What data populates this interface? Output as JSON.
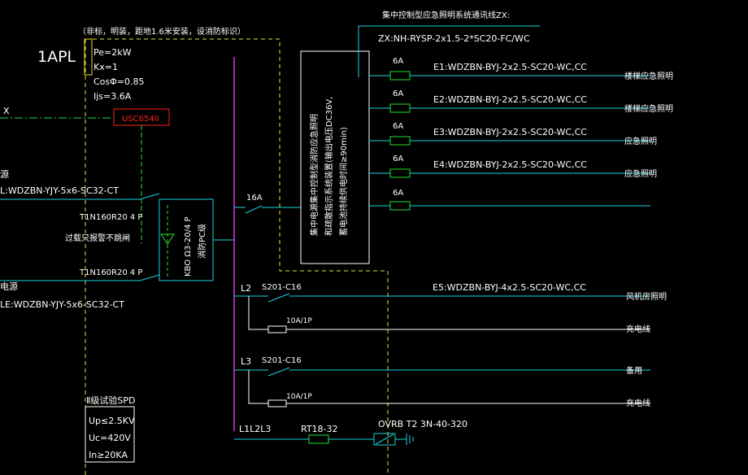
{
  "panel": {
    "name": "1APL",
    "install_note": "（非标，明装，距地1.6米安装，设消防标识）",
    "params": [
      "Pe=2kW",
      "Kx=1",
      "CosΦ=0.85",
      "Ijs=3.6A"
    ]
  },
  "incoming": {
    "line1_prefix": "X",
    "box_label": "USC654II",
    "feed1_tail": "源",
    "feed1_label": "L:WDZBN-YJY-5x6-SC32-CT",
    "feed2_tail": "电源",
    "feed2_label": "LE:WDZBN-YJY-5x6-SC32-CT",
    "breaker1": "T1N160R20 4 P",
    "breaker2": "T1N160R20 4 P",
    "overload_note": "过载只报警不跳闸",
    "ats_label": "KBO Ω3-20/4 P",
    "ats_sub": "消防PC级"
  },
  "emergency": {
    "header": "集中控制型应急照明系统通讯线ZX:",
    "comm_cable": "ZX:NH-RYSP-2x1.5-2*SC20-FC/WC",
    "supply_breaker": "16A",
    "controller_lines": [
      "集中电源集中控制型消防应急照明",
      "和疏散指示系统装置(输出电压DC36V,",
      "蓄电池持续供电时间≥90min)"
    ],
    "circuits": [
      {
        "fuse": "6A",
        "cable": "E1:WDZBN-BYJ-2x2.5-SC20-WC,CC",
        "load": "楼梯应急照明"
      },
      {
        "fuse": "6A",
        "cable": "E2:WDZBN-BYJ-2x2.5-SC20-WC,CC",
        "load": "楼梯应急照明"
      },
      {
        "fuse": "6A",
        "cable": "E3:WDZBN-BYJ-2x2.5-SC20-WC,CC",
        "load": "应急照明"
      },
      {
        "fuse": "6A",
        "cable": "E4:WDZBN-BYJ-2x2.5-SC20-WC,CC",
        "load": "应急照明"
      },
      {
        "fuse": "6A",
        "cable": "",
        "load": ""
      }
    ]
  },
  "branches": [
    {
      "phase": "L2",
      "breaker": "S201-C16",
      "cable": "E5:WDZBN-BYJ-4x2.5-SC20-WC,CC",
      "load": "风机房照明",
      "sub_breaker": "10A/1P",
      "sub_load": "充电线"
    },
    {
      "phase": "L3",
      "breaker": "S201-C16",
      "cable": "",
      "load": "备用",
      "sub_breaker": "10A/1P",
      "sub_load": "充电线"
    }
  ],
  "spd": {
    "title": "Ⅱ级试验SPD",
    "phase": "L1L2L3",
    "fuse": "RT18-32",
    "model": "OVRB T2 3N-40-320",
    "params": [
      "Up≤2.5KV",
      "Uc=420V",
      "In≥20KA"
    ]
  },
  "colors": {
    "cyan": "#19d3e0",
    "white": "#ffffff",
    "green": "#22e033",
    "yellow": "#e8e23a",
    "magenta": "#d23ad8",
    "red": "#ff2020"
  }
}
